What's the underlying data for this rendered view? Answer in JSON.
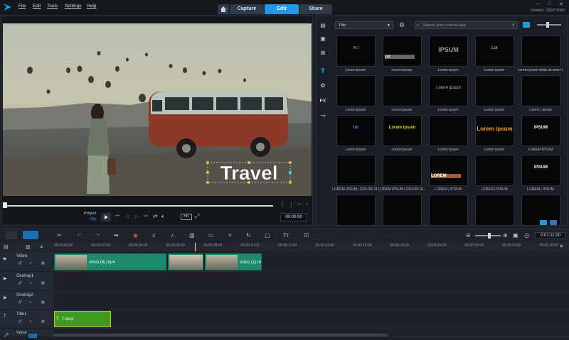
{
  "menu": [
    "File",
    "Edit",
    "Tools",
    "Settings",
    "Help"
  ],
  "window_title": "Untitled, 1920*1080",
  "tabs": [
    "Capture",
    "Edit",
    "Share"
  ],
  "overlay_title": "Travel",
  "player": {
    "mode_project": "Project",
    "mode_clip": "Clip",
    "timecode": "00:00:00"
  },
  "library": {
    "filter": "Title",
    "search_placeholder": "Search your current view",
    "titles": [
      {
        "text": "m  l",
        "label": "Lorem ipsum"
      },
      {
        "text": "Lor",
        "label": "Lorem ipsum"
      },
      {
        "text": "IPSUM",
        "label": "Lorem ipsum"
      },
      {
        "text": "Lor",
        "label": "Lorem ipsum"
      },
      {
        "text": "",
        "label": "Lorem ipsum dolor sit amet L"
      },
      {
        "text": "",
        "label": "Lorem ipsum"
      },
      {
        "text": "",
        "label": "Lorem ipsum"
      },
      {
        "text": "Lorem ipsum",
        "label": "Lorem ipsum"
      },
      {
        "text": "",
        "label": "Lorem ipsum"
      },
      {
        "text": "",
        "label": "Lorem | ipsum"
      },
      {
        "text": "lor",
        "label": "Lorem ipsum"
      },
      {
        "text": "Lorem ipsum",
        "label": "Lorem ipsum"
      },
      {
        "text": "",
        "label": "Lorem ipsum"
      },
      {
        "text": "Lorem ipsum",
        "label": "Lorem ipsum"
      },
      {
        "text": "IPSUM",
        "label": "LOREM IPSUM"
      },
      {
        "text": "",
        "label": "LOREM IPSUM | DOLOR SI..."
      },
      {
        "text": "",
        "label": "LOREM IPSUM | DOLOR SI..."
      },
      {
        "text": "LOREM",
        "label": "LOREM | IPSUM"
      },
      {
        "text": "",
        "label": "LOREM | IPSUM"
      },
      {
        "text": "IPSUM",
        "label": "LOREM | IPSUM"
      },
      {
        "text": "",
        "label": ""
      },
      {
        "text": "",
        "label": ""
      },
      {
        "text": "",
        "label": ""
      },
      {
        "text": "",
        "label": ""
      },
      {
        "text": "",
        "label": ""
      }
    ]
  },
  "timeline": {
    "timecode": "0:01:11:00",
    "ticks": [
      "00:00:00:00",
      "00:00:02:00",
      "00:00:04:00",
      "00:00:06:00",
      "00:00:08:00",
      "00:00:10:00",
      "00:00:12:00",
      "00:00:14:00",
      "00:00:16:00",
      "00:00:18:00",
      "00:00:20:00",
      "00:00:22:00",
      "00:00:24:00",
      "00:00:26:00"
    ],
    "tracks": [
      {
        "name": "Video",
        "clips": [
          "video (6).mp4",
          "",
          "video (1).m"
        ]
      },
      {
        "name": "Overlay1",
        "clips": []
      },
      {
        "name": "Overlay2",
        "clips": []
      },
      {
        "name": "Title1",
        "clips": [
          "Travel"
        ]
      },
      {
        "name": "Voice",
        "clips": []
      }
    ]
  },
  "colors": {
    "accent": "#1e9be6",
    "clip": "#1e8a6c",
    "title_clip": "#3f9a1e"
  }
}
